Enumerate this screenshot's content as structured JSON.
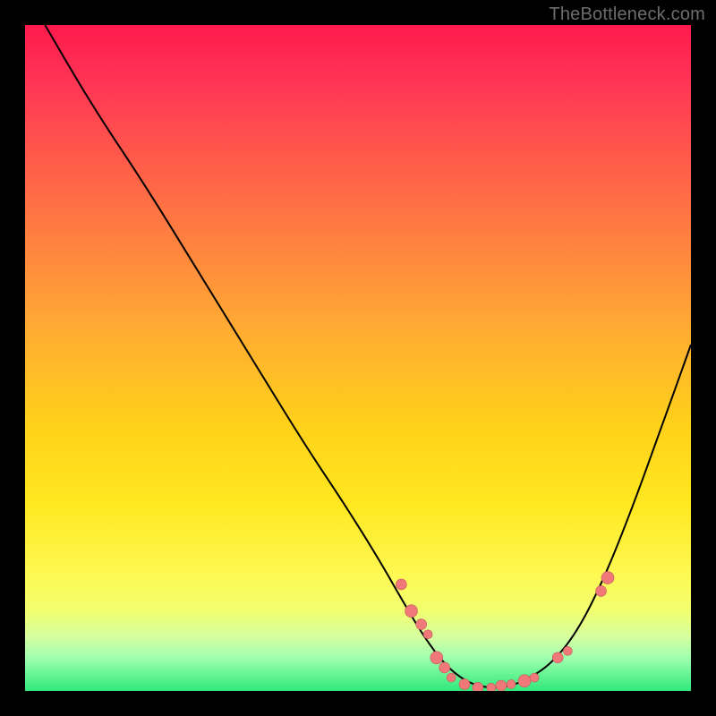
{
  "watermark": "TheBottleneck.com",
  "colors": {
    "curve": "#000000",
    "marker_fill": "#f07878",
    "marker_stroke": "#c25a5a"
  },
  "chart_data": {
    "type": "line",
    "title": "",
    "xlabel": "",
    "ylabel": "",
    "xlim": [
      0,
      100
    ],
    "ylim": [
      0,
      100
    ],
    "series": [
      {
        "name": "bottleneck-curve",
        "x": [
          3,
          10,
          18,
          26,
          34,
          42,
          48,
          53,
          57,
          60,
          63,
          66,
          69,
          72,
          75,
          79,
          83,
          87,
          91,
          95,
          100
        ],
        "y": [
          100,
          88,
          76,
          63,
          50,
          37,
          28,
          20,
          13,
          8,
          4,
          1.5,
          0.5,
          0.5,
          1.5,
          4,
          9,
          17,
          27,
          38,
          52
        ]
      }
    ],
    "markers": [
      {
        "x": 56.5,
        "y": 16,
        "r": 6
      },
      {
        "x": 58,
        "y": 12,
        "r": 7
      },
      {
        "x": 59.5,
        "y": 10,
        "r": 6
      },
      {
        "x": 60.5,
        "y": 8.5,
        "r": 5
      },
      {
        "x": 61.8,
        "y": 5,
        "r": 7
      },
      {
        "x": 63,
        "y": 3.5,
        "r": 6
      },
      {
        "x": 64,
        "y": 2,
        "r": 5
      },
      {
        "x": 66,
        "y": 1,
        "r": 6
      },
      {
        "x": 68,
        "y": 0.5,
        "r": 6
      },
      {
        "x": 70,
        "y": 0.5,
        "r": 5
      },
      {
        "x": 71.5,
        "y": 0.8,
        "r": 6
      },
      {
        "x": 73,
        "y": 1,
        "r": 5
      },
      {
        "x": 75,
        "y": 1.5,
        "r": 7
      },
      {
        "x": 76.5,
        "y": 2,
        "r": 5
      },
      {
        "x": 80,
        "y": 5,
        "r": 6
      },
      {
        "x": 81.5,
        "y": 6,
        "r": 5
      },
      {
        "x": 86.5,
        "y": 15,
        "r": 6
      },
      {
        "x": 87.5,
        "y": 17,
        "r": 7
      }
    ]
  }
}
